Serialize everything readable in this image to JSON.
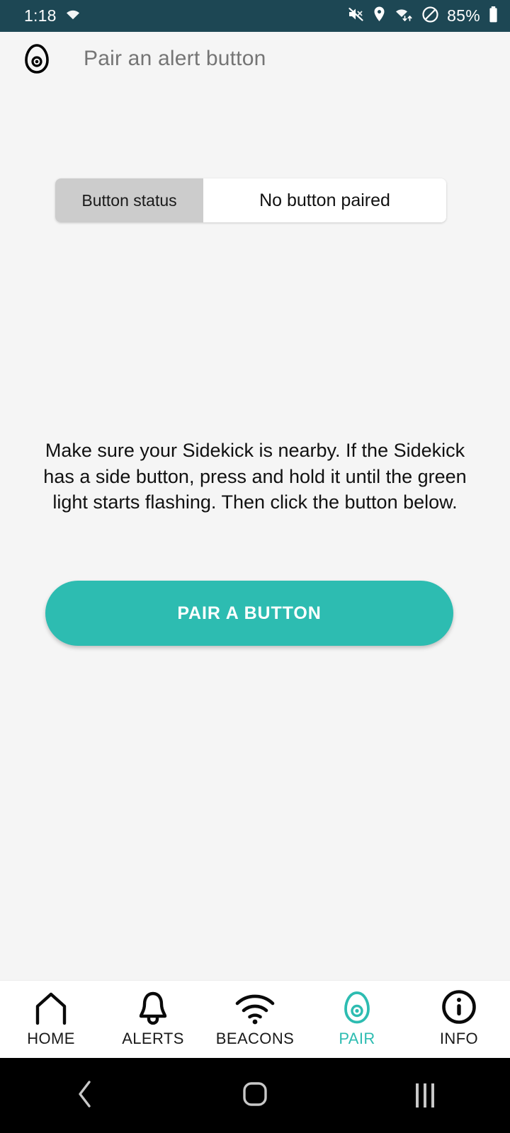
{
  "status_bar": {
    "time": "1:18",
    "battery_percent": "85%",
    "icons": [
      "wifi-icon",
      "mute-icon",
      "location-icon",
      "wifi-data-icon",
      "do-not-disturb-icon",
      "battery-icon"
    ]
  },
  "app_bar": {
    "logo": "avocado-logo-icon",
    "title": "Pair an alert button"
  },
  "status_chip": {
    "label": "Button status",
    "value": "No button paired"
  },
  "main": {
    "instructions": "Make sure your Sidekick is nearby. If the Sidekick has a side button, press and hold it until the green light starts flashing. Then click the button below.",
    "pair_button_label": "PAIR A BUTTON"
  },
  "tab_bar": {
    "active": "PAIR",
    "items": [
      {
        "label": "HOME",
        "icon": "house-icon"
      },
      {
        "label": "ALERTS",
        "icon": "bell-icon"
      },
      {
        "label": "BEACONS",
        "icon": "wifi-icon"
      },
      {
        "label": "PAIR",
        "icon": "avocado-icon"
      },
      {
        "label": "INFO",
        "icon": "info-circle-icon"
      }
    ]
  },
  "android_nav": {
    "back": "back-chevron-icon",
    "home": "home-square-icon",
    "recents": "recents-bars-icon"
  },
  "colors": {
    "status_bar_bg": "#1D4754",
    "accent_teal": "#2DBCB1",
    "page_bg": "#F5F5F5",
    "chip_gray": "#CCCCCC",
    "title_gray": "#757575"
  }
}
